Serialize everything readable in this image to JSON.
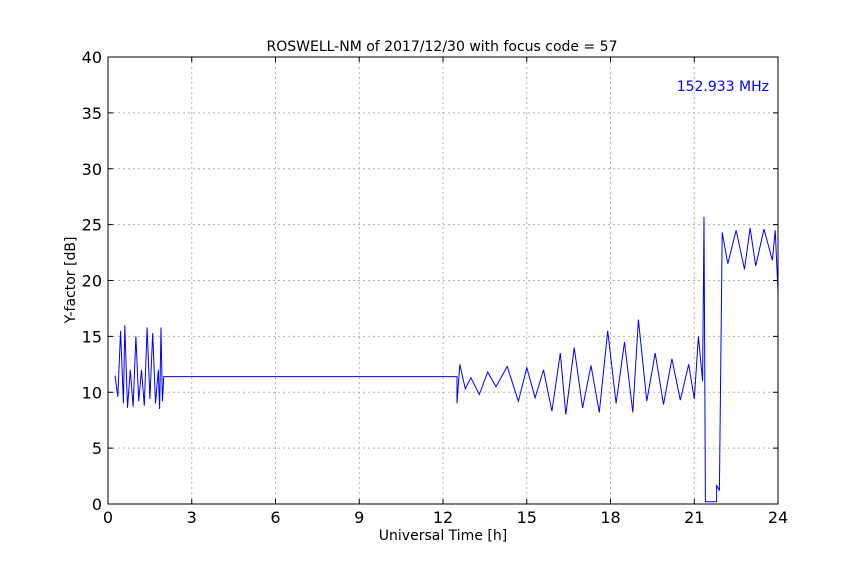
{
  "chart_data": {
    "type": "line",
    "title": "ROSWELL-NM of 2017/12/30 with focus code = 57",
    "xlabel": "Universal Time [h]",
    "ylabel": "Y-factor [dB]",
    "annotation": "152.933 MHz",
    "xlim": [
      0,
      24
    ],
    "ylim": [
      0,
      40
    ],
    "xticks": [
      0,
      3,
      6,
      9,
      12,
      15,
      18,
      21,
      24
    ],
    "yticks": [
      0,
      5,
      10,
      15,
      20,
      25,
      30,
      35,
      40
    ],
    "grid": true,
    "colors": {
      "series": "#0000ff",
      "annotation": "#0000ff",
      "grid": "#b0b0b0",
      "axes": "#000000"
    },
    "series": [
      {
        "values": [
          [
            0.25,
            11.5
          ],
          [
            0.35,
            9.6
          ],
          [
            0.45,
            15.5
          ],
          [
            0.55,
            9.0
          ],
          [
            0.6,
            16.0
          ],
          [
            0.7,
            8.6
          ],
          [
            0.8,
            12.0
          ],
          [
            0.9,
            8.7
          ],
          [
            1.0,
            15.0
          ],
          [
            1.1,
            9.2
          ],
          [
            1.2,
            12.0
          ],
          [
            1.3,
            8.8
          ],
          [
            1.4,
            15.8
          ],
          [
            1.5,
            9.4
          ],
          [
            1.6,
            15.3
          ],
          [
            1.7,
            9.0
          ],
          [
            1.8,
            12.0
          ],
          [
            1.85,
            8.5
          ],
          [
            1.9,
            15.8
          ],
          [
            1.95,
            9.2
          ],
          [
            2.0,
            11.4
          ],
          [
            12.5,
            11.4
          ],
          [
            12.5,
            9.0
          ],
          [
            12.6,
            12.5
          ],
          [
            12.8,
            10.3
          ],
          [
            13.0,
            11.3
          ],
          [
            13.3,
            9.8
          ],
          [
            13.6,
            11.8
          ],
          [
            13.9,
            10.5
          ],
          [
            14.3,
            12.3
          ],
          [
            14.7,
            9.2
          ],
          [
            15.0,
            12.2
          ],
          [
            15.3,
            9.5
          ],
          [
            15.6,
            12.0
          ],
          [
            15.9,
            8.3
          ],
          [
            16.2,
            13.5
          ],
          [
            16.4,
            8.0
          ],
          [
            16.7,
            14.0
          ],
          [
            17.0,
            8.6
          ],
          [
            17.3,
            12.4
          ],
          [
            17.6,
            8.2
          ],
          [
            17.9,
            15.5
          ],
          [
            18.2,
            9.0
          ],
          [
            18.5,
            14.5
          ],
          [
            18.8,
            8.2
          ],
          [
            19.0,
            16.5
          ],
          [
            19.3,
            9.2
          ],
          [
            19.6,
            13.5
          ],
          [
            19.9,
            8.9
          ],
          [
            20.2,
            13.0
          ],
          [
            20.5,
            9.3
          ],
          [
            20.8,
            12.5
          ],
          [
            21.0,
            9.4
          ],
          [
            21.15,
            15.0
          ],
          [
            21.3,
            11.0
          ],
          [
            21.35,
            25.7
          ],
          [
            21.4,
            0.2
          ],
          [
            21.8,
            0.2
          ],
          [
            21.8,
            1.7
          ],
          [
            21.9,
            1.2
          ],
          [
            22.0,
            24.3
          ],
          [
            22.2,
            21.5
          ],
          [
            22.5,
            24.5
          ],
          [
            22.8,
            21.0
          ],
          [
            23.0,
            24.7
          ],
          [
            23.2,
            21.3
          ],
          [
            23.5,
            24.6
          ],
          [
            23.8,
            21.8
          ],
          [
            23.9,
            24.5
          ],
          [
            24.0,
            19.0
          ]
        ]
      }
    ]
  }
}
